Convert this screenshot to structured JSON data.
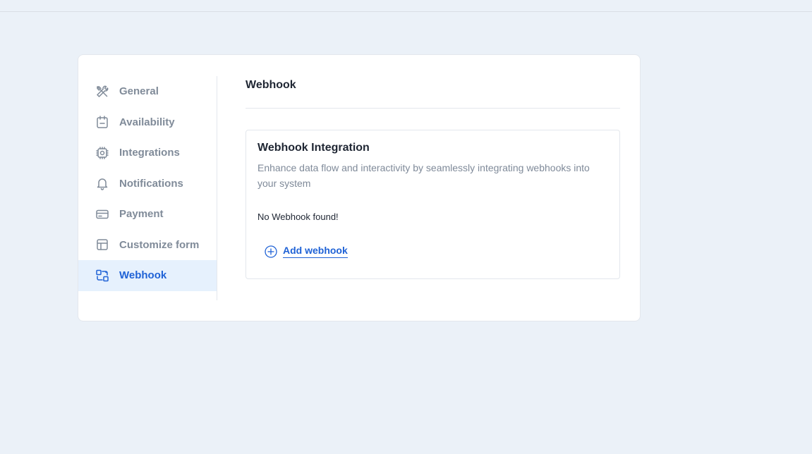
{
  "sidebar": {
    "items": [
      {
        "label": "General",
        "icon": "tools-icon",
        "active": false
      },
      {
        "label": "Availability",
        "icon": "calendar-icon",
        "active": false
      },
      {
        "label": "Integrations",
        "icon": "chip-icon",
        "active": false
      },
      {
        "label": "Notifications",
        "icon": "bell-icon",
        "active": false
      },
      {
        "label": "Payment",
        "icon": "credit-card-icon",
        "active": false
      },
      {
        "label": "Customize form",
        "icon": "layout-icon",
        "active": false
      },
      {
        "label": "Webhook",
        "icon": "webhook-icon",
        "active": true
      }
    ]
  },
  "main": {
    "title": "Webhook",
    "panel": {
      "title": "Webhook Integration",
      "description": "Enhance data flow and interactivity by seamlessly integrating webhooks into your system",
      "empty_message": "No Webhook found!",
      "add_label": "Add webhook"
    }
  },
  "colors": {
    "accent": "#1f62d6",
    "active_bg": "#e6f1fd",
    "muted_text": "#808b99",
    "page_bg": "#ebf1f8"
  }
}
